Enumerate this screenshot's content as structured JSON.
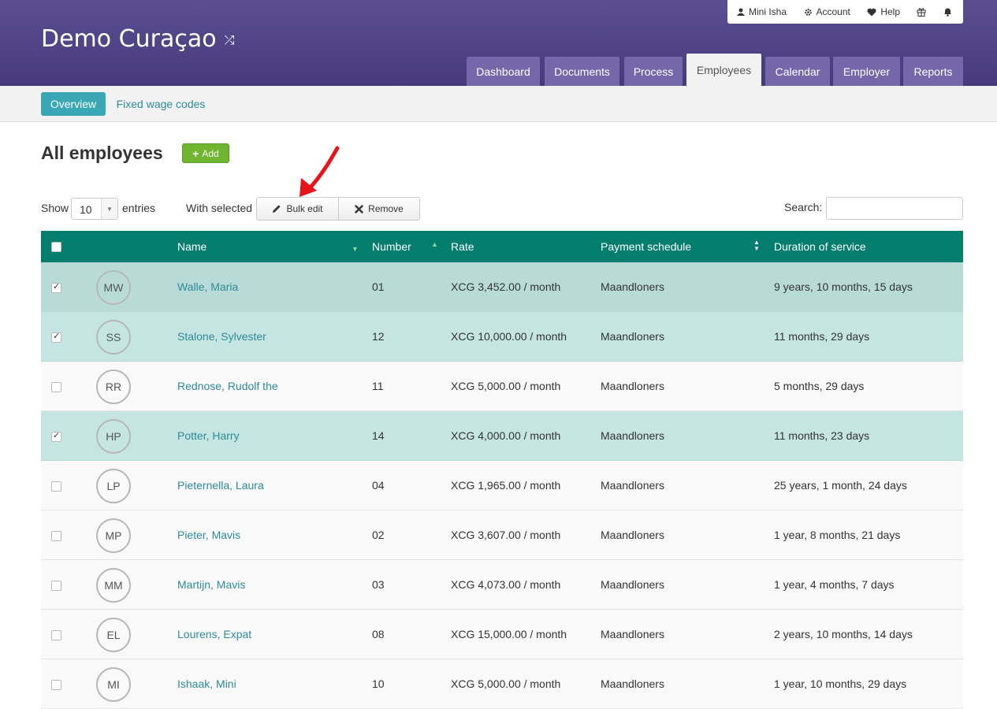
{
  "app": {
    "title": "Demo Curaçao",
    "shuffle_icon": "shuffle-icon"
  },
  "user_menu": {
    "user": "Mini Isha",
    "account": "Account",
    "help": "Help"
  },
  "tabs": [
    "Dashboard",
    "Documents",
    "Process",
    "Employees",
    "Calendar",
    "Employer",
    "Reports"
  ],
  "active_tab": "Employees",
  "subnav": {
    "overview": "Overview",
    "fixed_wage_codes": "Fixed wage codes"
  },
  "page": {
    "title": "All employees",
    "add_label": "Add"
  },
  "controls": {
    "show_label": "Show",
    "entries_value": "10",
    "entries_label": "entries",
    "with_selected_label": "With selected",
    "bulk_edit_label": "Bulk edit",
    "remove_label": "Remove",
    "search_label": "Search:",
    "search_value": ""
  },
  "table": {
    "headers": {
      "name": "Name",
      "number": "Number",
      "rate": "Rate",
      "payment_schedule": "Payment schedule",
      "duration": "Duration of service"
    },
    "rows": [
      {
        "initials": "MW",
        "name": "Walle, Maria",
        "number": "01",
        "rate": "XCG 3,452.00 / month",
        "schedule": "Maandloners",
        "duration": "9 years, 10 months, 15 days",
        "selected": true
      },
      {
        "initials": "SS",
        "name": "Stalone, Sylvester",
        "number": "12",
        "rate": "XCG 10,000.00 / month",
        "schedule": "Maandloners",
        "duration": "11 months, 29 days",
        "selected": true
      },
      {
        "initials": "RR",
        "name": "Rednose, Rudolf the",
        "number": "11",
        "rate": "XCG 5,000.00 / month",
        "schedule": "Maandloners",
        "duration": "5 months, 29 days",
        "selected": false
      },
      {
        "initials": "HP",
        "name": "Potter, Harry",
        "number": "14",
        "rate": "XCG 4,000.00 / month",
        "schedule": "Maandloners",
        "duration": "11 months, 23 days",
        "selected": true
      },
      {
        "initials": "LP",
        "name": "Pieternella, Laura",
        "number": "04",
        "rate": "XCG 1,965.00 / month",
        "schedule": "Maandloners",
        "duration": "25 years, 1 month, 24 days",
        "selected": false
      },
      {
        "initials": "MP",
        "name": "Pieter, Mavis",
        "number": "02",
        "rate": "XCG 3,607.00 / month",
        "schedule": "Maandloners",
        "duration": "1 year, 8 months, 21 days",
        "selected": false
      },
      {
        "initials": "MM",
        "name": "Martijn, Mavis",
        "number": "03",
        "rate": "XCG 4,073.00 / month",
        "schedule": "Maandloners",
        "duration": "1 year, 4 months, 7 days",
        "selected": false
      },
      {
        "initials": "EL",
        "name": "Lourens, Expat",
        "number": "08",
        "rate": "XCG 15,000.00 / month",
        "schedule": "Maandloners",
        "duration": "2 years, 10 months, 14 days",
        "selected": false
      },
      {
        "initials": "MI",
        "name": "Ishaak, Mini",
        "number": "10",
        "rate": "XCG 5,000.00 / month",
        "schedule": "Maandloners",
        "duration": "1 year, 10 months, 29 days",
        "selected": false
      }
    ]
  },
  "colors": {
    "header_bg": "#4f4388",
    "tab_bg": "#7468aa",
    "table_header_bg": "#037d6e",
    "selected_row_bg": "#c5e5e2",
    "accent": "#3aa8b4",
    "add_button": "#6fb52f",
    "annotation_arrow": "#e8141b"
  }
}
